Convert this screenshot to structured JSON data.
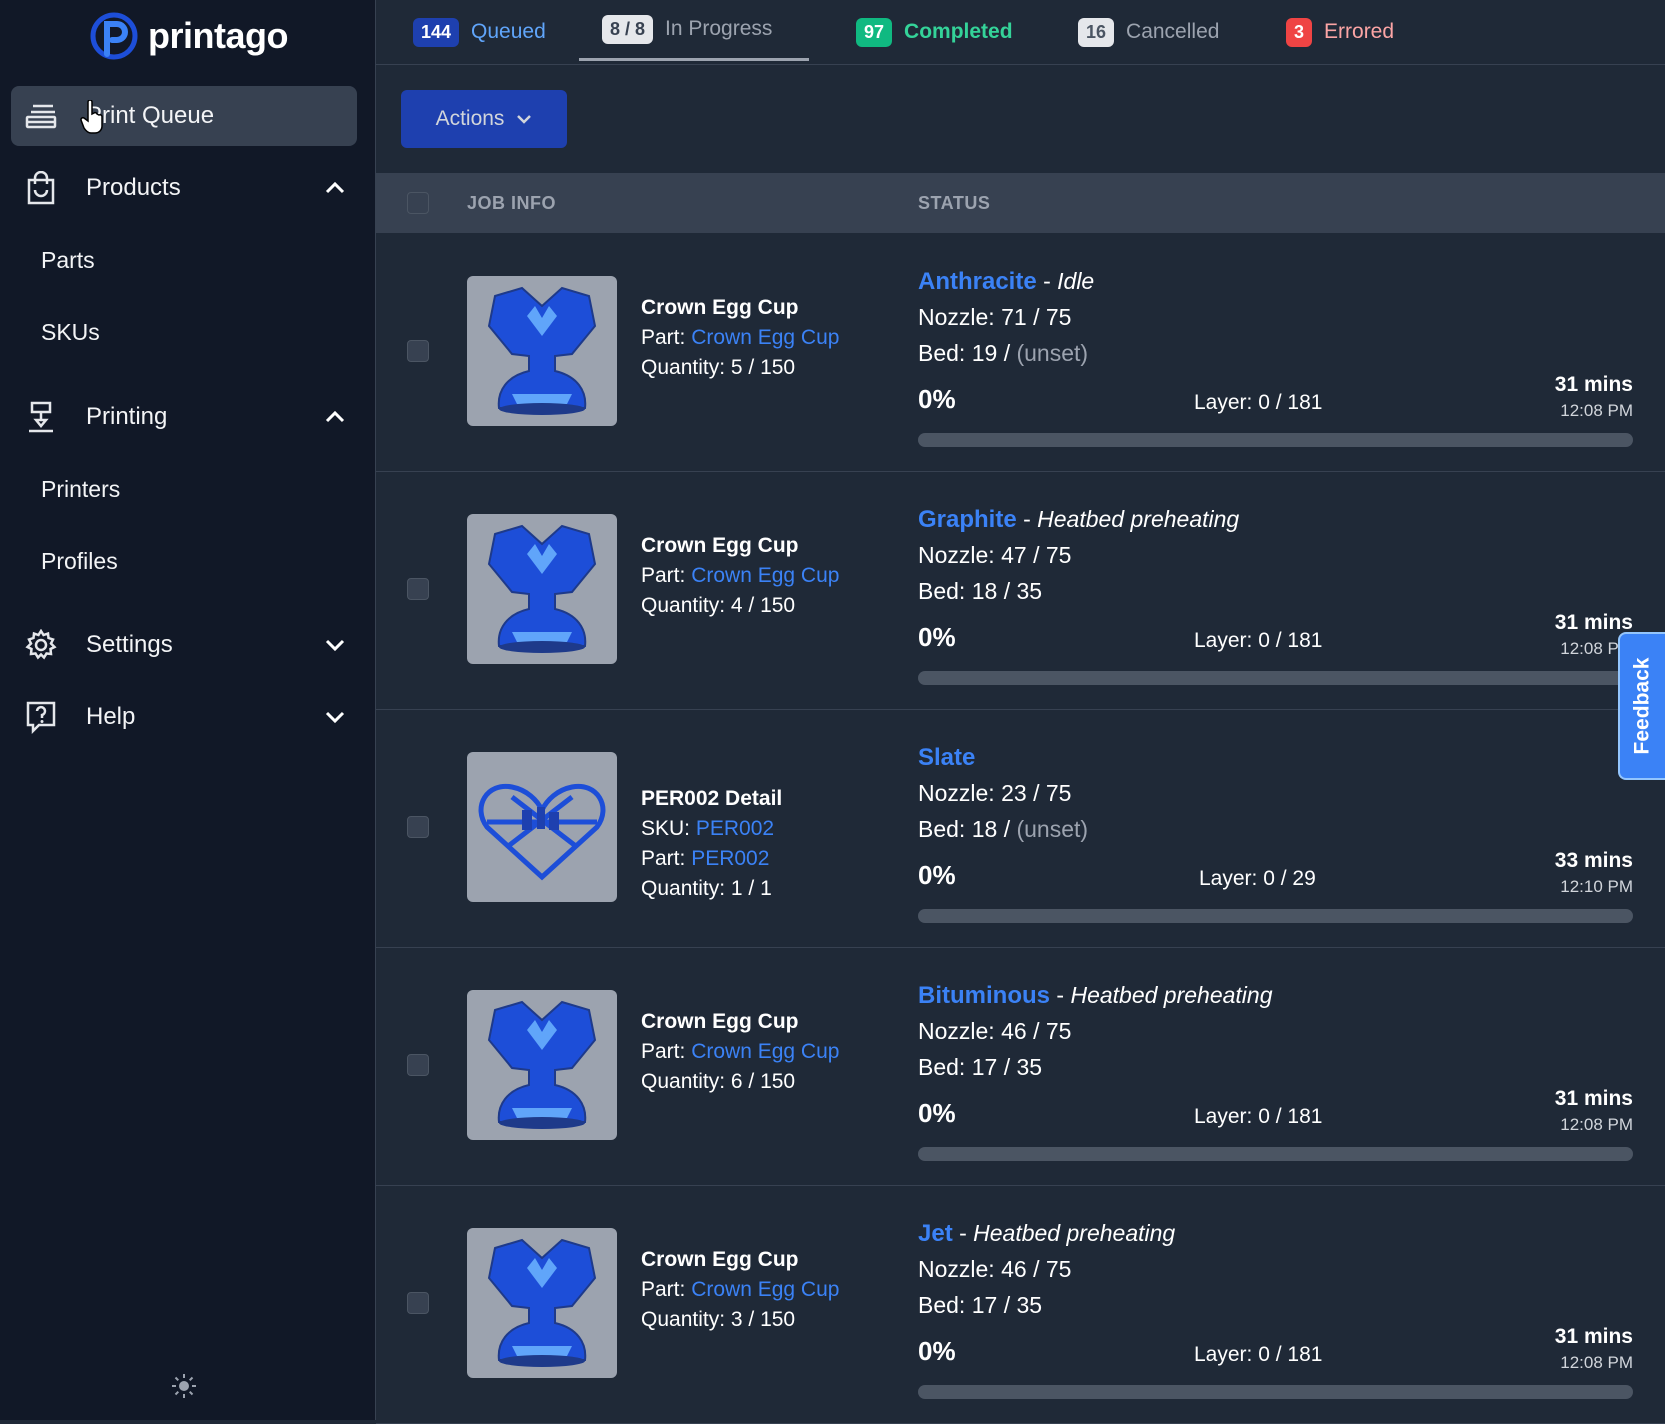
{
  "brand": {
    "name": "printago"
  },
  "sidebar": {
    "items": [
      {
        "label": "Print Queue",
        "icon": "queue-icon"
      },
      {
        "label": "Products",
        "icon": "shopping-bag-icon"
      },
      {
        "label": "Printing",
        "icon": "printer-icon"
      },
      {
        "label": "Settings",
        "icon": "gear-icon"
      },
      {
        "label": "Help",
        "icon": "help-icon"
      }
    ],
    "products_sub": [
      "Parts",
      "SKUs"
    ],
    "printing_sub": [
      "Printers",
      "Profiles"
    ]
  },
  "tabs": [
    {
      "count": "144",
      "label": "Queued",
      "badge_color": "#1e40af",
      "text_color": "#60a5fa"
    },
    {
      "count": "8 / 8",
      "label": "In Progress",
      "badge_color": "#e5e7eb",
      "text_color": "#9ca3af"
    },
    {
      "count": "97",
      "label": "Completed",
      "badge_color": "#10b981",
      "text_color": "#34d399"
    },
    {
      "count": "16",
      "label": "Cancelled",
      "badge_color": "#e5e7eb",
      "text_color": "#9ca3af"
    },
    {
      "count": "3",
      "label": "Errored",
      "badge_color": "#ef4444",
      "text_color": "#fca5a5"
    }
  ],
  "toolbar": {
    "actions_label": "Actions"
  },
  "table": {
    "headers": {
      "job_info": "JOB INFO",
      "status": "STATUS"
    }
  },
  "labels": {
    "part": "Part: ",
    "sku": "SKU: ",
    "quantity": "Quantity: ",
    "nozzle": "Nozzle: ",
    "bed": "Bed: ",
    "layer": "Layer: ",
    "unset": "(unset)"
  },
  "jobs": [
    {
      "name": "Crown Egg Cup",
      "part": "Crown Egg Cup",
      "quantity": "5 / 150",
      "printer": "Anthracite",
      "state": "Idle",
      "nozzle": "71 / 75",
      "bed": "19 / ",
      "bed_unset": true,
      "percent": "0%",
      "layer": "0 / 181",
      "mins": "31 mins",
      "time": "12:08 PM",
      "progress": 0
    },
    {
      "name": "Crown Egg Cup",
      "part": "Crown Egg Cup",
      "quantity": "4 / 150",
      "printer": "Graphite",
      "state": "Heatbed preheating",
      "nozzle": "47 / 75",
      "bed": "18 / 35",
      "bed_unset": false,
      "percent": "0%",
      "layer": "0 / 181",
      "mins": "31 mins",
      "time": "12:08 PM",
      "progress": 0
    },
    {
      "name": "PER002 Detail",
      "sku": "PER002",
      "part": "PER002",
      "quantity": "1 / 1",
      "printer": "Slate",
      "state": "",
      "nozzle": "23 / 75",
      "bed": "18 / ",
      "bed_unset": true,
      "percent": "0%",
      "layer": "0 / 29",
      "mins": "33 mins",
      "time": "12:10 PM",
      "progress": 0
    },
    {
      "name": "Crown Egg Cup",
      "part": "Crown Egg Cup",
      "quantity": "6 / 150",
      "printer": "Bituminous",
      "state": "Heatbed preheating",
      "nozzle": "46 / 75",
      "bed": "17 / 35",
      "bed_unset": false,
      "percent": "0%",
      "layer": "0 / 181",
      "mins": "31 mins",
      "time": "12:08 PM",
      "progress": 0
    },
    {
      "name": "Crown Egg Cup",
      "part": "Crown Egg Cup",
      "quantity": "3 / 150",
      "printer": "Jet",
      "state": "Heatbed preheating",
      "nozzle": "46 / 75",
      "bed": "17 / 35",
      "bed_unset": false,
      "percent": "0%",
      "layer": "0 / 181",
      "mins": "31 mins",
      "time": "12:08 PM",
      "progress": 0
    }
  ],
  "feedback": {
    "label": "Feedback"
  }
}
